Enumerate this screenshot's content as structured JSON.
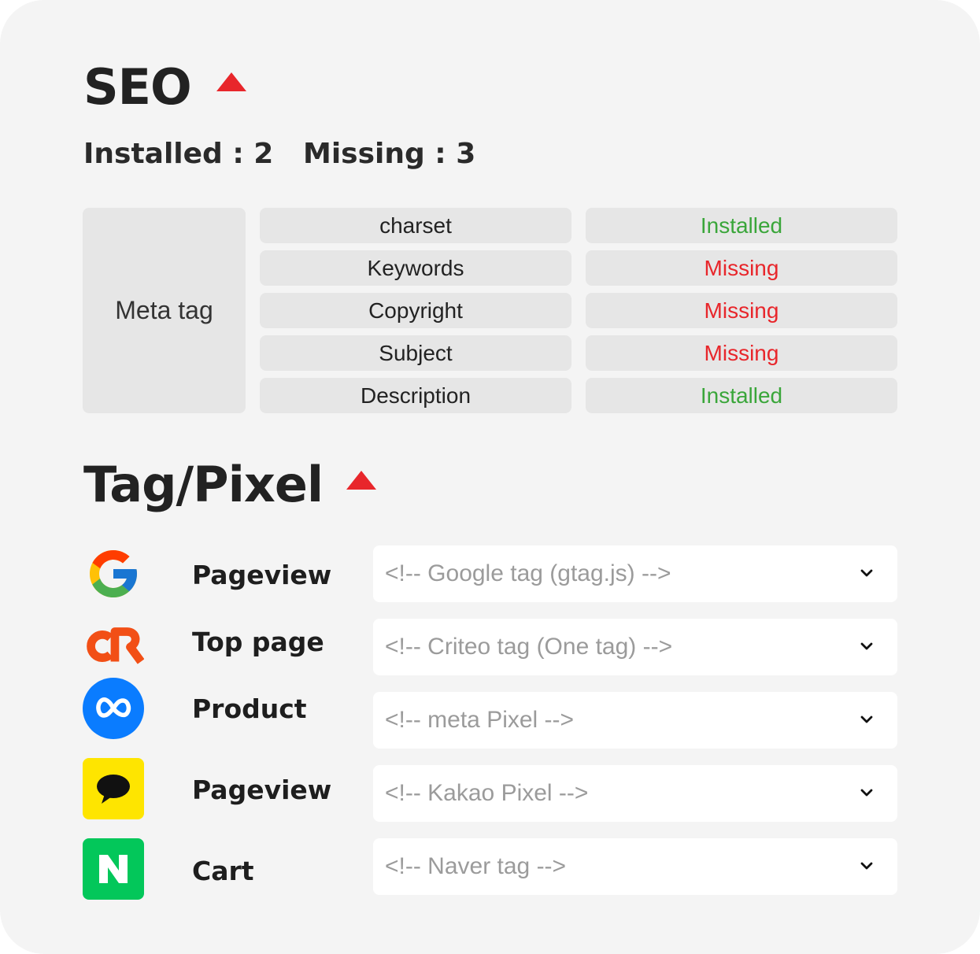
{
  "seo": {
    "title": "SEO",
    "installed_label": "Installed : 2",
    "missing_label": "Missing : 3",
    "group_label": "Meta tag",
    "rows": [
      {
        "name": "charset",
        "status": "Installed"
      },
      {
        "name": "Keywords",
        "status": "Missing"
      },
      {
        "name": "Copyright",
        "status": "Missing"
      },
      {
        "name": "Subject",
        "status": "Missing"
      },
      {
        "name": "Description",
        "status": "Installed"
      }
    ]
  },
  "tag_pixel": {
    "title": "Tag/Pixel",
    "rows": [
      {
        "icon": "google-icon",
        "event": "Pageview",
        "selected": "<!-- Google tag (gtag.js) -->"
      },
      {
        "icon": "criteo-icon",
        "event": "Top page",
        "selected": "<!-- Criteo tag (One tag) -->"
      },
      {
        "icon": "meta-icon",
        "event": "Product",
        "selected": "<!-- meta Pixel -->"
      },
      {
        "icon": "kakao-icon",
        "event": "Pageview",
        "selected": "<!-- Kakao Pixel -->"
      },
      {
        "icon": "naver-icon",
        "event": "Cart",
        "selected": "<!-- Naver tag -->"
      }
    ]
  },
  "colors": {
    "installed": "#3aa63a",
    "missing": "#e8262b",
    "accent_triangle": "#e8262b",
    "background": "#f4f4f4",
    "cell": "#e6e6e6"
  }
}
